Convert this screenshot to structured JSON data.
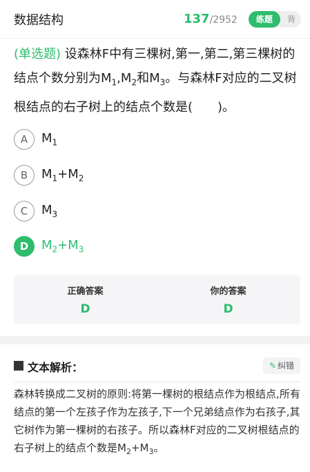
{
  "header": {
    "title": "数据结构",
    "counter_current": "137",
    "counter_sep": "/",
    "counter_total": "2952",
    "mode_practice": "练题",
    "mode_memorize": "背"
  },
  "question": {
    "type": "(单选题)",
    "text_1": "设森林F中有三棵树,第一,第二,第三棵树的结点个数分别为M",
    "sub_1": "1",
    "text_2": ",M",
    "sub_2": "2",
    "text_3": "和M",
    "sub_3": "3",
    "text_4": "。与森林F对应的二叉树根结点的右子树上的结点个数是(　　)。"
  },
  "options": [
    {
      "letter": "A",
      "p1": "M",
      "s1": "1",
      "p2": "",
      "p3": "",
      "s3": ""
    },
    {
      "letter": "B",
      "p1": "M",
      "s1": "1",
      "p2": "+",
      "p3": "M",
      "s3": "2"
    },
    {
      "letter": "C",
      "p1": "M",
      "s1": "3",
      "p2": "",
      "p3": "",
      "s3": ""
    },
    {
      "letter": "D",
      "p1": "M",
      "s1": "2",
      "p2": "+",
      "p3": "M",
      "s3": "3"
    }
  ],
  "answers": {
    "correct_label": "正确答案",
    "correct_value": "D",
    "yours_label": "你的答案",
    "yours_value": "D"
  },
  "analysis": {
    "title": "文本解析：",
    "correct_btn": "纠错",
    "text_1": "森林转换成二叉树的原则:将第一棵树的根结点作为根结点,所有结点的第一个左孩子作为左孩子,下一个兄弟结点作为右孩子,其它树作为第一棵树的右孩子。所以森林F对应的二叉树根结点的右子树上的结点个数是M",
    "sub_1": "2",
    "text_2": "+M",
    "sub_2": "3",
    "text_3": "。"
  },
  "colors": {
    "accent": "#2ebc6d",
    "text": "#222222",
    "muted": "#888888",
    "panel": "#f5f5f7"
  },
  "icons": {
    "section_marker": "square-icon",
    "correction": "pen-icon"
  }
}
